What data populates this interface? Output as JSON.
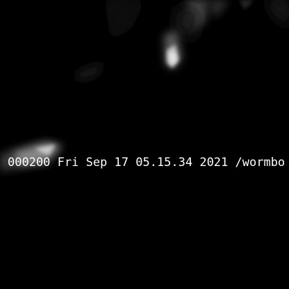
{
  "overlay": {
    "caption": "000200 Fri Sep 17 05.15.34 2021 /wormbo"
  },
  "colors": {
    "background": "#000000",
    "text": "#ffffff",
    "highlight": "#d8d8d8"
  }
}
